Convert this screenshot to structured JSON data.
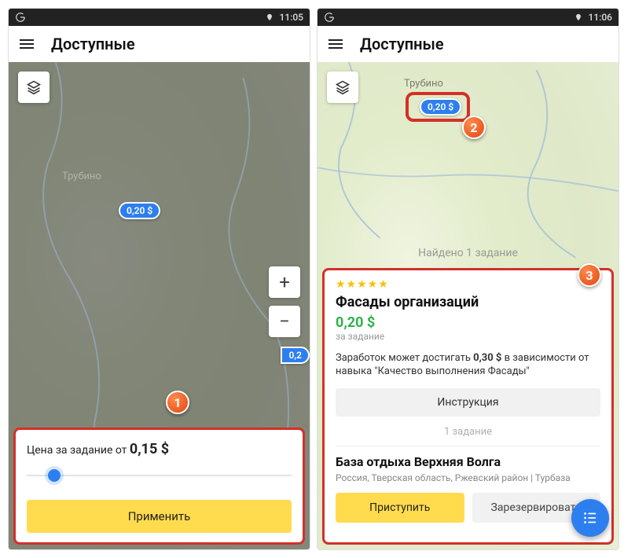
{
  "status": {
    "time_left": "11:05",
    "time_right": "11:06"
  },
  "header": {
    "title": "Доступные"
  },
  "left": {
    "map_label": "Трубино",
    "pin_price": "0,20 $",
    "pin_price_half": "0,2",
    "filter": {
      "label": "Цена за задание от ",
      "value": "0,15 $",
      "apply": "Применить"
    },
    "callout": "1"
  },
  "right": {
    "map_label": "Трубино",
    "pin_price": "0,20 $",
    "found": "Найдено 1 задание",
    "callouts": {
      "pin": "2",
      "panel": "3"
    },
    "task": {
      "stars": "★★★★★",
      "title": "Фасады организаций",
      "price": "0,20 $",
      "price_sub": "за задание",
      "desc_pre": "Заработок может достигать ",
      "desc_bold": "0,30 $",
      "desc_post": " в зависимости от навыка \"Качество выполнения Фасады\"",
      "instruction": "Инструкция",
      "count": "1 задание",
      "place_title": "База отдыха Верхняя Волга",
      "place_sub": "Россия, Тверская область, Ржевский район | Турбаза",
      "start": "Приступить",
      "reserve": "Зарезервировать"
    }
  }
}
